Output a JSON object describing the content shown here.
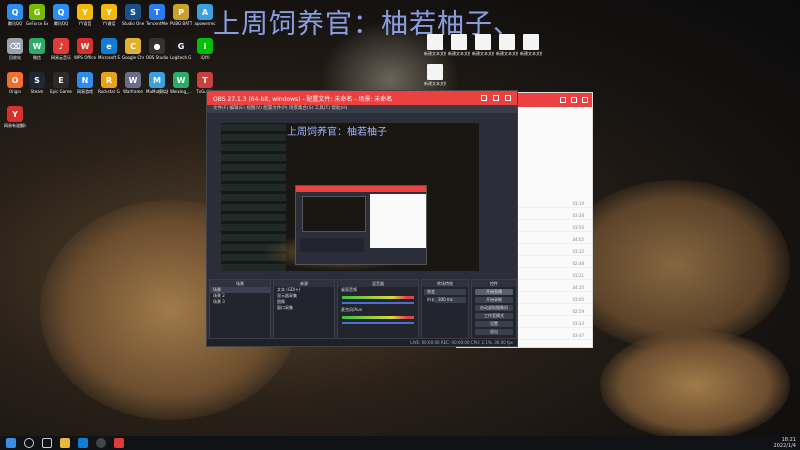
{
  "banner_text": "上周饲养官：柚若柚子、",
  "desktop": {
    "icons": [
      {
        "label": "腾讯QQ",
        "color": "#2d8cf0",
        "glyph": "Q"
      },
      {
        "label": "GeForce Experience",
        "color": "#76b900",
        "glyph": "G"
      },
      {
        "label": "腾讯QQ",
        "color": "#2d8cf0",
        "glyph": "Q"
      },
      {
        "label": "YY语音",
        "color": "#f0b90b",
        "glyph": "Y"
      },
      {
        "label": "YY通话",
        "color": "#f0b90b",
        "glyph": "Y"
      },
      {
        "label": "Studio One 5",
        "color": "#1b4f8a",
        "glyph": "S"
      },
      {
        "label": "TencentMeeting",
        "color": "#2b7bf0",
        "glyph": "T"
      },
      {
        "label": "PUBG BATTLEGROUNDS",
        "color": "#c9a227",
        "glyph": "P"
      },
      {
        "label": "apowerrec",
        "color": "#3aa0e0",
        "glyph": "A"
      },
      {
        "label": "回收站",
        "color": "#9aa4ad",
        "glyph": "⌫"
      },
      {
        "label": "微信",
        "color": "#2aae67",
        "glyph": "W"
      },
      {
        "label": "网易云音乐",
        "color": "#e03b3b",
        "glyph": "♪"
      },
      {
        "label": "WPS Office",
        "color": "#d8302b",
        "glyph": "W"
      },
      {
        "label": "Microsoft Edge",
        "color": "#0f7fd6",
        "glyph": "e"
      },
      {
        "label": "Google Chrome",
        "color": "#e0b030",
        "glyph": "C"
      },
      {
        "label": "OBS Studio",
        "color": "#333333",
        "glyph": "●"
      },
      {
        "label": "Logitech G HUB",
        "color": "#1a1a1a",
        "glyph": "G"
      },
      {
        "label": "iQIYI",
        "color": "#00be06",
        "glyph": "i"
      },
      {
        "label": "Origin",
        "color": "#f56c2d",
        "glyph": "O"
      },
      {
        "label": "Steam",
        "color": "#1b2838",
        "glyph": "S"
      },
      {
        "label": "Epic Games Launcher",
        "color": "#2b2b2b",
        "glyph": "E"
      },
      {
        "label": "网易游戏",
        "color": "#2d8cf0",
        "glyph": "N"
      },
      {
        "label": "Rockstar Games",
        "color": "#e8a317",
        "glyph": "R"
      },
      {
        "label": "Warframe",
        "color": "#6b6b8a",
        "glyph": "W"
      },
      {
        "label": "MuMu模拟器",
        "color": "#3aa0e0",
        "glyph": "M"
      },
      {
        "label": "Weixing_...",
        "color": "#2aae67",
        "glyph": "W"
      },
      {
        "label": "TxGuiLib",
        "color": "#c94040",
        "glyph": "T"
      },
      {
        "label": "网易有道翻译",
        "color": "#d8302b",
        "glyph": "Y"
      }
    ],
    "files": [
      {
        "label": "新建文本文档 (2)"
      },
      {
        "label": "新建文本文档 (3)"
      },
      {
        "label": "新建文本文档 (4)"
      },
      {
        "label": "新建文本文档 (5)"
      },
      {
        "label": "新建文本文档 (6)"
      },
      {
        "label": "新建文本文档"
      }
    ]
  },
  "netease_window": {
    "times": [
      "03:10",
      "03:38",
      "03:56",
      "04:02",
      "03:15",
      "02:48",
      "03:21",
      "04:10",
      "03:05",
      "02:59",
      "03:33",
      "03:47"
    ]
  },
  "obs_window": {
    "title": "OBS 27.1.3 (64-bit, windows) - 配置文件: 未命名 - 场景: 未命名",
    "menu": "文件(F)  编辑(E)  视图(V)  配置文件(P)  场景集合(S)  工具(T)  帮助(H)",
    "preview_text": "上周饲养官：柚若柚子",
    "docks": {
      "scenes_title": "场景",
      "scenes": [
        "场景",
        "场景 2",
        "场景 3"
      ],
      "sources_title": "来源",
      "sources": [
        "文本 (GDI+)",
        "显示器采集",
        "图像",
        "窗口采集"
      ],
      "mixer_title": "混音器",
      "mixer_channels": [
        "桌面音频",
        "麦克风/Aux"
      ],
      "transitions_title": "转场特效",
      "transition_name": "渐变",
      "duration_label": "时长",
      "duration_value": "300 ms",
      "controls_title": "控件",
      "controls": [
        "开始直播",
        "开始录制",
        "启动虚拟摄像机",
        "工作室模式",
        "设置",
        "退出"
      ]
    },
    "status": "LIVE: 00:00:00  REC: 00:00:00  CPU: 2.1%, 30.00 fps"
  },
  "taskbar": {
    "time": "18:21",
    "date": "2022/1/4"
  }
}
